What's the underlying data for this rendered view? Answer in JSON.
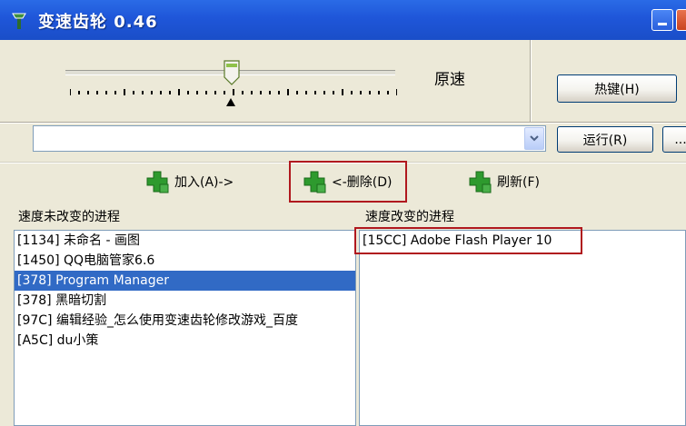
{
  "window": {
    "title": "变速齿轮 0.46"
  },
  "speed": {
    "label": "原速",
    "level_fraction": 0.5
  },
  "buttons": {
    "hotkey": "热键(H)",
    "run": "运行(R)",
    "more": "...",
    "add": "加入(A)->",
    "delete": "<-删除(D)",
    "refresh": "刷新(F)"
  },
  "process_combo": {
    "value": ""
  },
  "left_panel": {
    "header": "速度未改变的进程",
    "items": [
      {
        "text": "[1134] 未命名 - 画图",
        "selected": false
      },
      {
        "text": "[1450] QQ电脑管家6.6",
        "selected": false
      },
      {
        "text": "[378] Program Manager",
        "selected": true
      },
      {
        "text": "[378] 黑暗切割",
        "selected": false
      },
      {
        "text": "[97C] 编辑经验_怎么使用变速齿轮修改游戏_百度",
        "selected": false
      },
      {
        "text": "[A5C] du小策",
        "selected": false
      }
    ]
  },
  "right_panel": {
    "header": "速度改变的进程",
    "items": [
      {
        "text": "[15CC] Adobe Flash Player 10",
        "selected": false
      }
    ]
  },
  "colors": {
    "titlebar": "#1f56d9",
    "selection": "#316ac5",
    "highlight_box": "#b0181e",
    "plus_icon": "#2e9a2e"
  }
}
